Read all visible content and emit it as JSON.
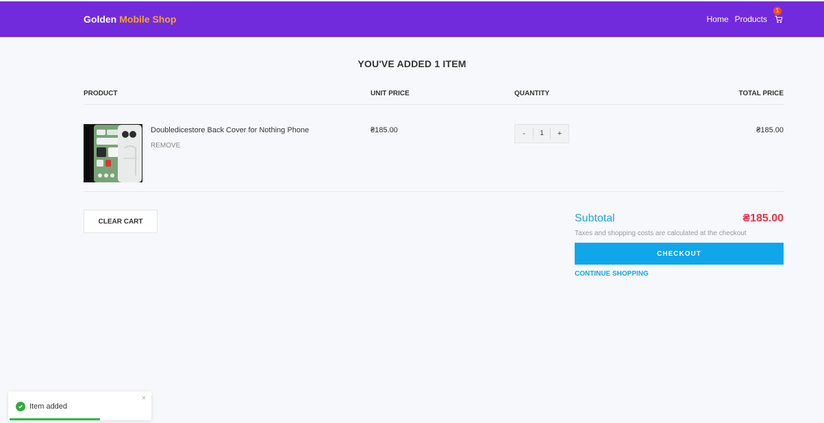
{
  "navbar": {
    "brand_main": "Golden",
    "brand_accent": "Mobile Shop",
    "links": [
      "Home",
      "Products"
    ],
    "cart_count": "1",
    "cart_icon": "cart-icon",
    "color": "#722bdc"
  },
  "page_title": "YOU'VE ADDED 1 ITEM",
  "table": {
    "headers": [
      "PRODUCT",
      "UNIT PRICE",
      "QUANTITY",
      "TOTAL PRICE"
    ],
    "rows": [
      {
        "product_name": "Doubledicestore Back Cover for Nothing Phone",
        "remove_label": "REMOVE",
        "unit_price": "₴185.00",
        "quantity": "1",
        "decrement": "-",
        "increment": "+",
        "total_price": "₴185.00"
      }
    ]
  },
  "actions": {
    "clear_cart": "CLEAR CART"
  },
  "summary": {
    "subtotal_label": "Subtotal",
    "subtotal_value": "₴185.00",
    "tax_note": "Taxes and shopping costs are calculated at the checkout",
    "checkout_label": "CHECKOUT",
    "continue_label": "CONTINUE SHOPPING"
  },
  "toast": {
    "message": "Item added",
    "close": "×",
    "progress": 0.63,
    "icon": "check-circle-icon"
  }
}
